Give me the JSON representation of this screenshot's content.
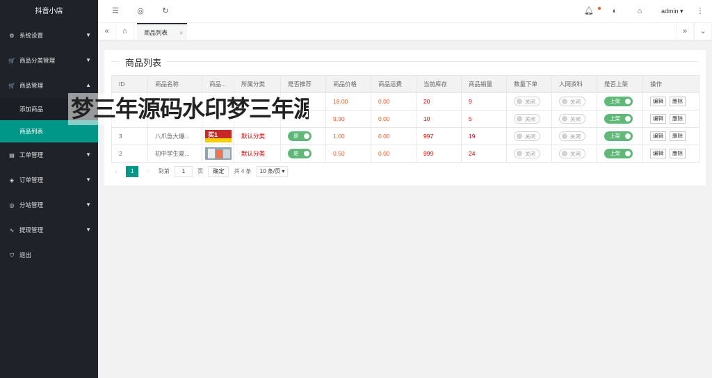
{
  "app": {
    "title": "抖音小店"
  },
  "sidebar": {
    "items": [
      {
        "label": "系统设置",
        "icon": "gear-icon",
        "glyph": "⚙",
        "arrow": "▼"
      },
      {
        "label": "商品分类管理",
        "icon": "cart-icon",
        "glyph": "🛒",
        "arrow": "▼"
      },
      {
        "label": "商品管理",
        "icon": "cart-icon",
        "glyph": "🛒",
        "arrow": "▲",
        "children": [
          {
            "label": "添加商品"
          },
          {
            "label": "商品列表",
            "active": true
          }
        ]
      },
      {
        "label": "工单管理",
        "icon": "ticket-icon",
        "glyph": "▤",
        "arrow": "▼"
      },
      {
        "label": "订单管理",
        "icon": "layers-icon",
        "glyph": "◈",
        "arrow": "▼"
      },
      {
        "label": "分站管理",
        "icon": "globe-icon",
        "glyph": "◎",
        "arrow": "▼"
      },
      {
        "label": "提现管理",
        "icon": "pulse-icon",
        "glyph": "∿",
        "arrow": "▼"
      },
      {
        "label": "退出",
        "icon": "shield-icon",
        "glyph": "⛉",
        "arrow": ""
      }
    ]
  },
  "header": {
    "user": "admin",
    "colors": {
      "notification_dot": "#ff5722"
    }
  },
  "tabs": {
    "active_label": "商品列表",
    "close": "×"
  },
  "panel": {
    "title": "商品列表"
  },
  "table": {
    "columns": [
      "ID",
      "商品名称",
      "商品...",
      "所属分类",
      "是否推荐",
      "商品价格",
      "商品运费",
      "当前库存",
      "商品销量",
      "数量下单",
      "入网资料",
      "是否上架",
      "操作"
    ],
    "rows": [
      {
        "id": "",
        "name": "",
        "category": "",
        "recommend": "",
        "price": "18.00",
        "freight": "0.00",
        "stock": "20",
        "sales": "9",
        "qty_order": "关闭",
        "network": "关闭",
        "listed": "上架",
        "edit": "编辑",
        "delete": "删除"
      },
      {
        "id": "",
        "name": "",
        "category": "",
        "recommend": "",
        "price": "9.90",
        "freight": "0.00",
        "stock": "10",
        "sales": "5",
        "qty_order": "关闭",
        "network": "关闭",
        "listed": "上架",
        "edit": "编辑",
        "delete": "删除"
      },
      {
        "id": "3",
        "name": "八爪鱼大爆...",
        "category": "默认分类",
        "recommend": "是",
        "price": "1.00",
        "freight": "0.00",
        "stock": "997",
        "sales": "19",
        "qty_order": "关闭",
        "network": "关闭",
        "listed": "上架",
        "edit": "编辑",
        "delete": "删除",
        "thumb_text": "买1"
      },
      {
        "id": "2",
        "name": "初中学生夏...",
        "category": "默认分类",
        "recommend": "是",
        "price": "0.50",
        "freight": "0.00",
        "stock": "999",
        "sales": "24",
        "qty_order": "关闭",
        "network": "关闭",
        "listed": "上架",
        "edit": "编辑",
        "delete": "删除",
        "thumb_text": ""
      }
    ]
  },
  "pager": {
    "current": "1",
    "goto_prefix": "到第",
    "goto_value": "1",
    "goto_suffix": "页",
    "confirm": "确定",
    "total": "共 4 条",
    "page_size": "10 条/页"
  },
  "watermark": {
    "text": "梦三年源码水印梦三年源码水印"
  },
  "colors": {
    "accent": "#009688",
    "sidebar_bg": "#20222a",
    "switch_on": "#5FB878",
    "price": "#ff5722"
  }
}
